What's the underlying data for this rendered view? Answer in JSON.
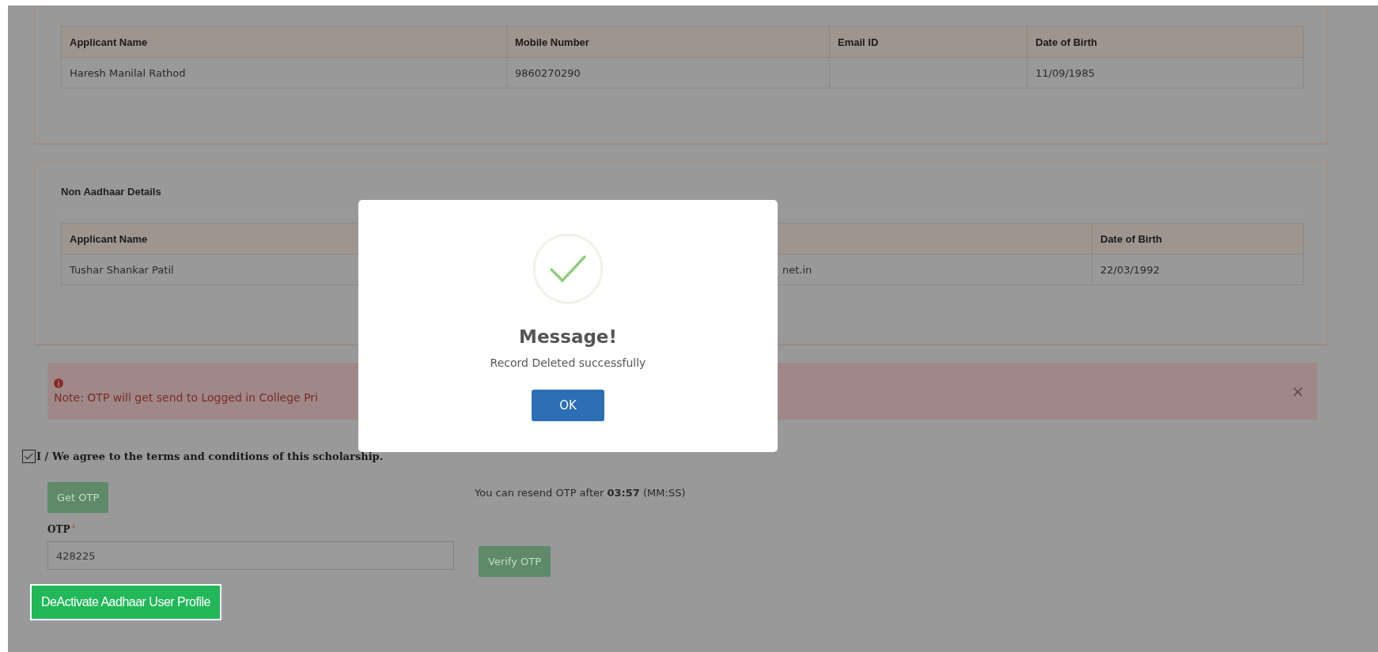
{
  "aadhaar_details": {
    "table": {
      "columns": [
        "Applicant Name",
        "Mobile Number",
        "Email ID",
        "Date of Birth"
      ],
      "rows": [
        [
          "Haresh Manilal Rathod",
          "9860270290",
          null,
          "11/09/1985"
        ]
      ]
    }
  },
  "non_aadhaar_details": {
    "title": "Non Aadhaar Details",
    "table": {
      "columns": [
        "Applicant Name",
        null,
        "Date of Birth"
      ],
      "rows": [
        [
          "Tushar Shankar Patil",
          "net.in",
          "22/03/1992"
        ]
      ]
    }
  },
  "alert": {
    "text": "Note: OTP will get send to Logged in College Pri",
    "close": "×"
  },
  "agreement": {
    "label": "I / We agree to the terms and conditions of this scholarship.",
    "checked": true
  },
  "get_otp": {
    "label": "Get OTP",
    "disabled": true
  },
  "resend_note": "You can resend OTP after **03:57** (MM:SS)",
  "otp_field": {
    "label": "OTP",
    "required_mark": "*",
    "value": "428225"
  },
  "verify_otp": {
    "label": "Verify OTP",
    "disabled": true
  },
  "deactivate_button": {
    "label": "DeActivate Aadhaar User Profile"
  },
  "dialog": {
    "title": "Message!",
    "message": "Record Deleted successfully",
    "button": "OK"
  }
}
